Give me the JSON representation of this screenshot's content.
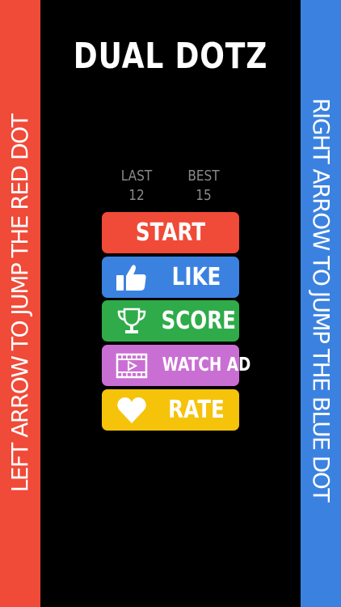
{
  "left_hint": "LEFT ARROW TO JUMP THE RED DOT",
  "right_hint": "RIGHT ARROW TO JUMP THE BLUE DOT",
  "title": "DUAL DOTZ",
  "stats": {
    "last_label": "LAST",
    "last_value": "12",
    "best_label": "BEST",
    "best_value": "15"
  },
  "buttons": {
    "start": "START",
    "like": "LIKE",
    "score": "SCORE",
    "watch_ad": "WATCH AD",
    "rate": "RATE"
  },
  "icons": {
    "like": "thumbs-up-icon",
    "score": "trophy-icon",
    "watch_ad": "video-icon",
    "rate": "heart-icon"
  },
  "colors": {
    "red": "#f04a38",
    "blue": "#3b82e0",
    "green": "#2fab49",
    "purple": "#c96fd3",
    "yellow": "#f5c30a",
    "background": "#000000"
  }
}
